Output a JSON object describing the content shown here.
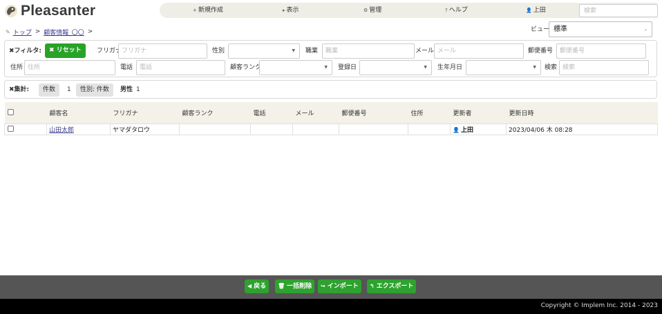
{
  "app": {
    "title": "Pleasanter"
  },
  "header": {
    "menu": [
      {
        "icon": "+",
        "label": "新規作成"
      },
      {
        "icon": "▸",
        "label": "表示"
      },
      {
        "icon": "⚙",
        "label": "管理"
      },
      {
        "icon": "?",
        "label": "ヘルプ"
      },
      {
        "icon": "👤",
        "label": "上田"
      }
    ],
    "search_placeholder": "検索"
  },
  "breadcrumb": {
    "items": [
      "トップ",
      "顧客情報_〇〇"
    ],
    "separator": ">"
  },
  "view": {
    "label": "ビュー",
    "selected": "標準"
  },
  "filter": {
    "title": "フィルタ:",
    "reset_label": "リセット",
    "fields": {
      "furigana": {
        "label": "フリガナ",
        "placeholder": "フリガナ"
      },
      "gender": {
        "label": "性別",
        "value": ""
      },
      "job": {
        "label": "職業",
        "placeholder": "職業"
      },
      "mail": {
        "label": "メール",
        "placeholder": "メール"
      },
      "postal": {
        "label": "郵便番号",
        "placeholder": "郵便番号"
      },
      "address": {
        "label": "住所",
        "placeholder": "住所"
      },
      "phone": {
        "label": "電話",
        "placeholder": "電話"
      },
      "rank": {
        "label": "顧客ランク",
        "value": ""
      },
      "registered": {
        "label": "登録日",
        "value": ""
      },
      "birthday": {
        "label": "生年月日",
        "value": ""
      },
      "search": {
        "label": "検索",
        "placeholder": "検索"
      }
    }
  },
  "summary": {
    "title": "集計:",
    "count_label": "件数",
    "count_value": "1",
    "group_label": "性別: 件数",
    "group_key": "男性",
    "group_value": "1"
  },
  "table": {
    "columns": [
      "顧客名",
      "フリガナ",
      "顧客ランク",
      "電話",
      "メール",
      "郵便番号",
      "住所",
      "更新者",
      "更新日時"
    ],
    "rows": [
      {
        "name": "山田太郎",
        "furigana": "ヤマダタロウ",
        "rank": "",
        "phone": "",
        "mail": "",
        "postal": "",
        "address": "",
        "updater": "上田",
        "updated_at": "2023/04/06 木 08:28"
      }
    ]
  },
  "actions": {
    "back": "戻る",
    "bulk_delete": "一括削除",
    "import": "インポート",
    "export": "エクスポート"
  },
  "footer": {
    "copyright": "Copyright © Implem Inc. 2014 - 2023"
  },
  "colors": {
    "accent_green": "#27a327",
    "header_bar": "#efeee6",
    "table_header": "#f3f1e8",
    "action_bar": "#555555",
    "link": "#3b3a90"
  }
}
